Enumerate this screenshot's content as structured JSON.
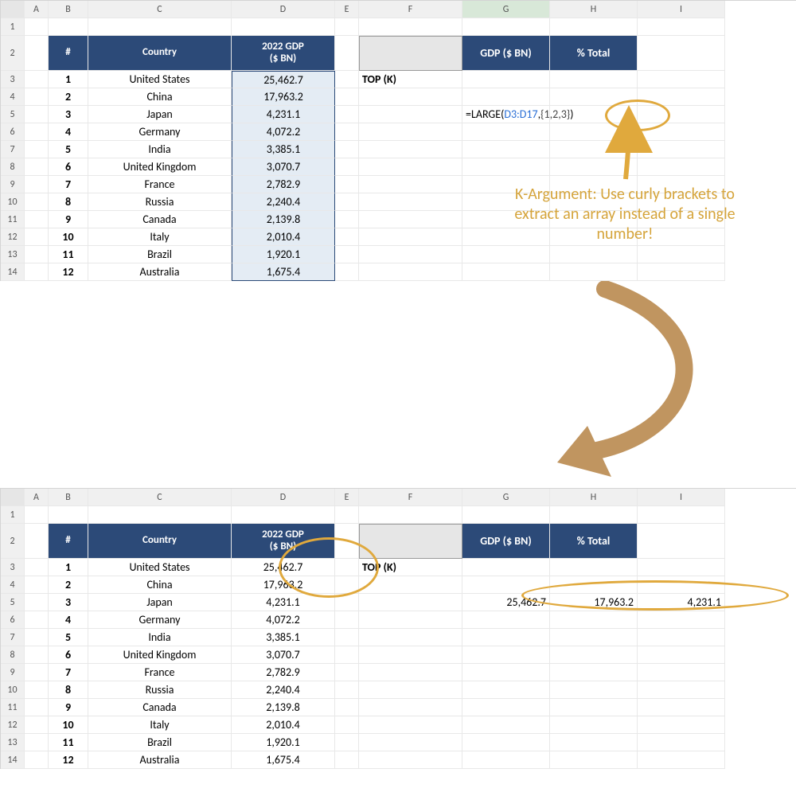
{
  "columns": [
    "A",
    "B",
    "C",
    "D",
    "E",
    "F",
    "G",
    "H",
    "I"
  ],
  "rows_top": [
    "1",
    "2",
    "3",
    "4",
    "5",
    "6",
    "7",
    "8",
    "9",
    "10",
    "11",
    "12",
    "13",
    "14"
  ],
  "table": {
    "h_num": "#",
    "h_country": "Country",
    "h_gdp_line1": "2022 GDP",
    "h_gdp_line2": "($ BN)",
    "rows": [
      {
        "n": "1",
        "c": "United States",
        "g": "25,462.7"
      },
      {
        "n": "2",
        "c": "China",
        "g": "17,963.2"
      },
      {
        "n": "3",
        "c": "Japan",
        "g": "4,231.1"
      },
      {
        "n": "4",
        "c": "Germany",
        "g": "4,072.2"
      },
      {
        "n": "5",
        "c": "India",
        "g": "3,385.1"
      },
      {
        "n": "6",
        "c": "United Kingdom",
        "g": "3,070.7"
      },
      {
        "n": "7",
        "c": "France",
        "g": "2,782.9"
      },
      {
        "n": "8",
        "c": "Russia",
        "g": "2,240.4"
      },
      {
        "n": "9",
        "c": "Canada",
        "g": "2,139.8"
      },
      {
        "n": "10",
        "c": "Italy",
        "g": "2,010.4"
      },
      {
        "n": "11",
        "c": "Brazil",
        "g": "1,920.1"
      },
      {
        "n": "12",
        "c": "Australia",
        "g": "1,675.4"
      }
    ]
  },
  "right": {
    "h_gdp": "GDP ($ BN)",
    "h_pct": "% Total",
    "topk": "TOP (K)"
  },
  "formula": {
    "prefix": "=LARGE(",
    "ref": "D3:D17",
    "mid": ",",
    "arr": "{1,2,3}",
    "suffix": ")"
  },
  "annotation": "K-Argument: Use curly brackets to extract an array instead of a single number!",
  "results": [
    "25,462.7",
    "17,963.2",
    "4,231.1"
  ]
}
